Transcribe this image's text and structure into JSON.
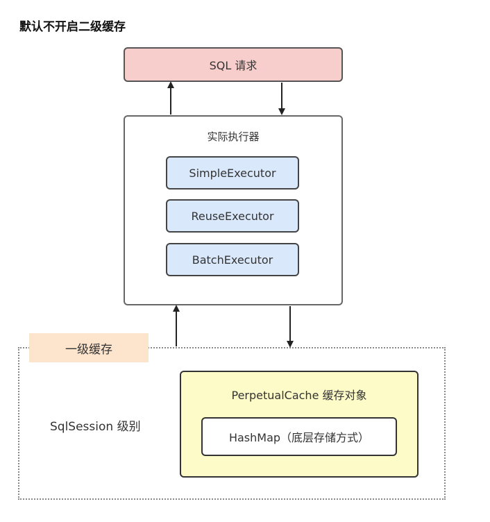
{
  "heading": "默认不开启二级缓存",
  "sql_request": "SQL 请求",
  "executor": {
    "title": "实际执行器",
    "items": [
      "SimpleExecutor",
      "ReuseExecutor",
      "BatchExecutor"
    ]
  },
  "first_level_cache": {
    "tag": "一级缓存",
    "scope_label": "SqlSession 级别",
    "cache_object": "PerpetualCache 缓存对象",
    "storage": "HashMap（底层存储方式）"
  },
  "colors": {
    "sql_fill": "#f8cecc",
    "executor_fill": "#dae8fc",
    "cache_tag_fill": "#fde4cc",
    "cache_object_fill": "#fdfbc8"
  }
}
